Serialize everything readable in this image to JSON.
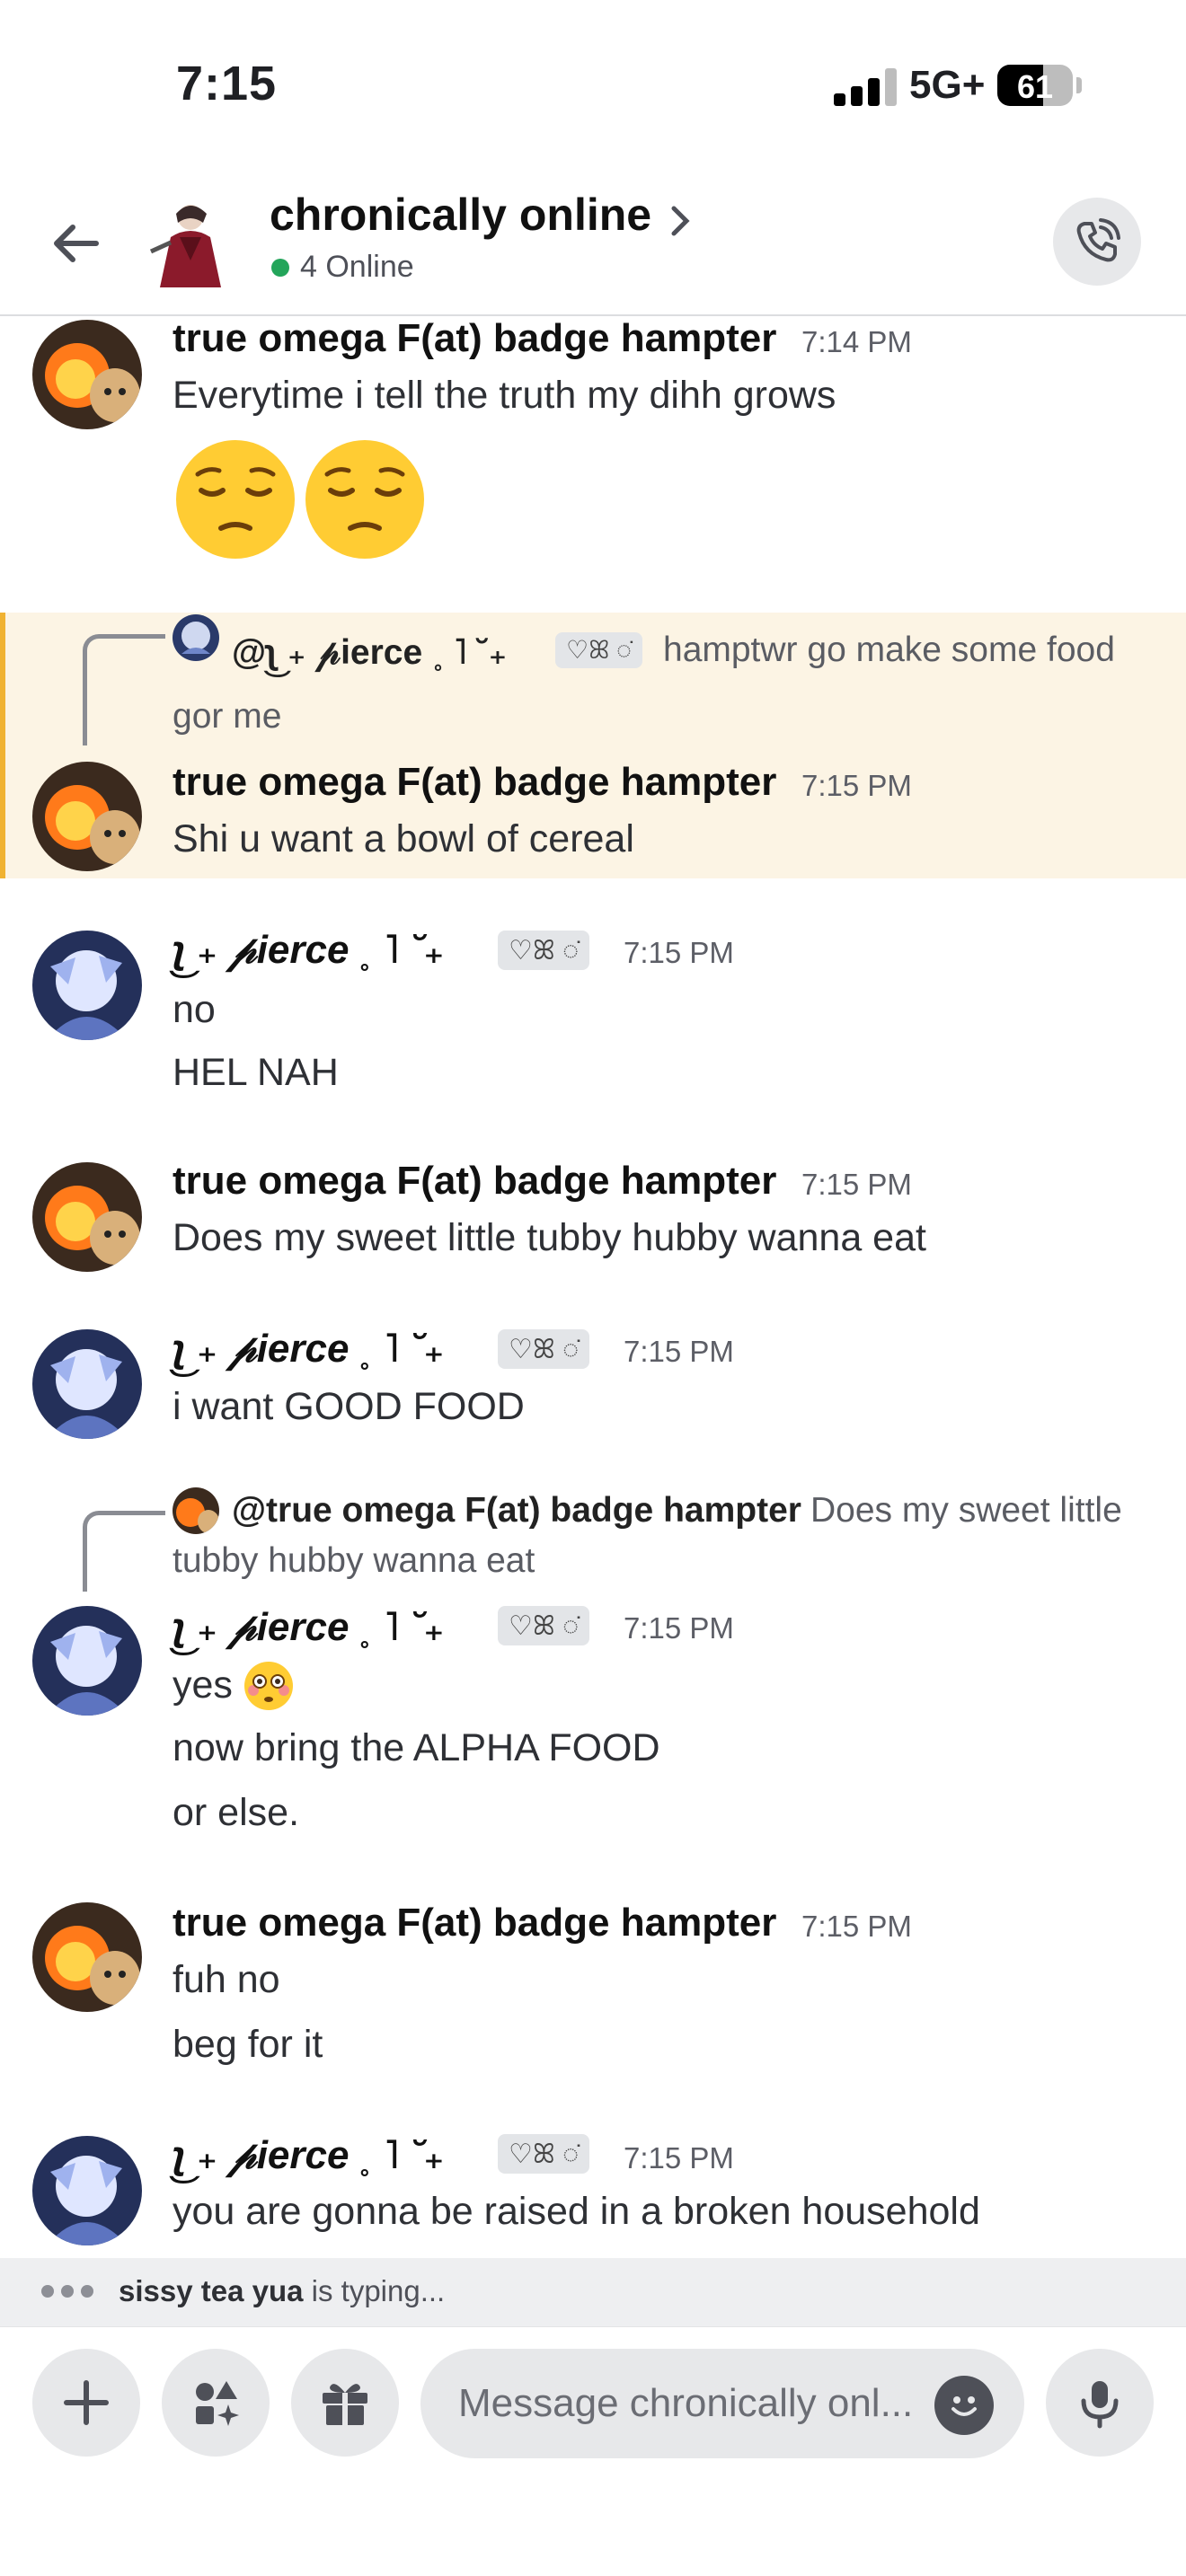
{
  "status_bar": {
    "time": "7:15",
    "network": "5G+",
    "battery_level": "61",
    "battery_fraction": 0.61
  },
  "header": {
    "title": "chronically online",
    "online_status": "4 Online"
  },
  "messages": [
    {
      "author": "true omega F(at) badge hampter",
      "time": "7:14 PM",
      "lines": [
        "Everytime i tell the truth my dihh grows"
      ],
      "emoji": "pensive-face x2"
    },
    {
      "reply": {
        "author": "@ʅ͜ ₊ 𝓅ierce ˳ ˥ ˘₊",
        "tag": "♡ꕤ ◌̇",
        "text_line1": "hamptwr go make some food",
        "text_line2": "gor me"
      },
      "author": "true omega F(at) badge hampter",
      "time": "7:15 PM",
      "lines": [
        "Shi u want a bowl of cereal"
      ]
    },
    {
      "author": "ʅ͜ ₊ 𝓅ierce ˳ ˥ ˘₊",
      "tag": "♡ꕤ ◌̇",
      "time": "7:15 PM",
      "lines": [
        "no",
        "HEL NAH"
      ]
    },
    {
      "author": "true omega F(at) badge hampter",
      "time": "7:15 PM",
      "lines": [
        "Does my sweet little tubby hubby wanna eat"
      ]
    },
    {
      "author": "ʅ͜ ₊ 𝓅ierce ˳ ˥ ˘₊",
      "tag": "♡ꕤ ◌̇",
      "time": "7:15 PM",
      "lines": [
        "i want GOOD FOOD"
      ]
    },
    {
      "reply": {
        "author": "@true omega F(at) badge hampter",
        "text_line1": "Does my sweet little",
        "text_line2": "tubby hubby wanna eat"
      },
      "author": "ʅ͜ ₊ 𝓅ierce ˳ ˥ ˘₊",
      "tag": "♡ꕤ ◌̇",
      "time": "7:15 PM",
      "lines": [
        "yes",
        "now bring the ALPHA FOOD",
        "or else."
      ]
    },
    {
      "author": "true omega F(at) badge hampter",
      "time": "7:15 PM",
      "lines": [
        "fuh no",
        "beg for it"
      ]
    },
    {
      "author": "ʅ͜ ₊ 𝓅ierce ˳ ˥ ˘₊",
      "tag": "♡ꕤ ◌̇",
      "time": "7:15 PM",
      "lines": [
        "you are gonna be raised in a broken household"
      ]
    }
  ],
  "typing": {
    "user": "sissy tea yua",
    "suffix": " is typing..."
  },
  "composer": {
    "placeholder": "Message chronically onl..."
  },
  "icons": [
    "back-arrow-icon",
    "chevron-right-icon",
    "phone-call-icon",
    "plus-icon",
    "apps-icon",
    "gift-icon",
    "emoji-icon",
    "microphone-icon"
  ],
  "colors": {
    "online": "#23a55a",
    "highlight_bg": "#fcf4e4",
    "highlight_border": "#f0b232"
  }
}
